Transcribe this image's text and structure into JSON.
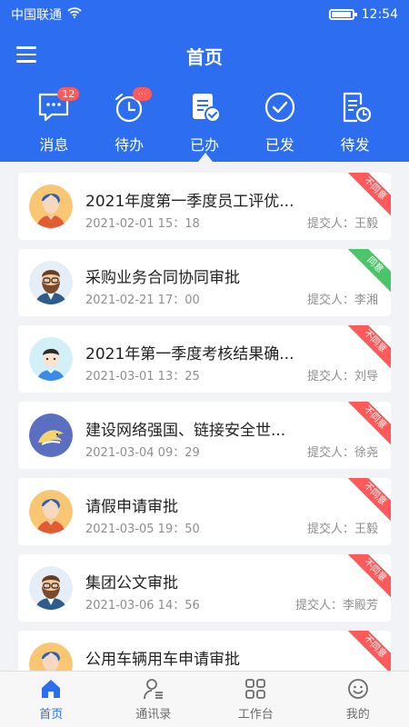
{
  "status": {
    "carrier": "中国联通",
    "time": "12:54",
    "battery_level": 0.95
  },
  "header": {
    "title": "首页"
  },
  "tabs": [
    {
      "label": "消息",
      "icon": "message-icon",
      "badge": "12"
    },
    {
      "label": "待办",
      "icon": "alarm-clock-icon",
      "badge": "···"
    },
    {
      "label": "已办",
      "icon": "document-check-icon",
      "active": true
    },
    {
      "label": "已发",
      "icon": "check-circle-icon"
    },
    {
      "label": "待发",
      "icon": "document-clock-icon"
    }
  ],
  "items": [
    {
      "title": "2021年度第一季度员工评优...",
      "date": "2021-02-01   15：18",
      "submitter": "提交人：王毅",
      "status": "不同意",
      "status_color": "#ff5a5a",
      "avatar": "avatar-woman-orange"
    },
    {
      "title": "采购业务合同协同审批",
      "date": "2021-02-21   17：00",
      "submitter": "提交人：李湘",
      "status": "同意",
      "status_color": "#4cc46a",
      "avatar": "avatar-man-beard"
    },
    {
      "title": "2021年第一季度考核结果确...",
      "date": "2021-03-01   13：25",
      "submitter": "提交人：刘导",
      "status": "不同意",
      "status_color": "#ff5a5a",
      "avatar": "avatar-boy-blue"
    },
    {
      "title": "建设网络强国、链接安全世...",
      "date": "2021-03-04   09：29",
      "submitter": "提交人：徐尧",
      "status": "不同意",
      "status_color": "#ff5a5a",
      "avatar": "avatar-dolphin-logo"
    },
    {
      "title": "请假申请审批",
      "date": "2021-03-05   19：50",
      "submitter": "提交人：王毅",
      "status": "不同意",
      "status_color": "#ff5a5a",
      "avatar": "avatar-woman-orange"
    },
    {
      "title": "集团公文审批",
      "date": "2021-03-06   14：56",
      "submitter": "提交人：李殿芳",
      "status": "不同意",
      "status_color": "#ff5a5a",
      "avatar": "avatar-man-beard"
    },
    {
      "title": "公用车辆用车申请审批",
      "date": "",
      "submitter": "",
      "status": "不同意",
      "status_color": "#ff5a5a",
      "avatar": "avatar-woman-orange"
    }
  ],
  "bottom_nav": [
    {
      "label": "首页",
      "icon": "home-icon",
      "active": true
    },
    {
      "label": "通讯录",
      "icon": "contacts-icon"
    },
    {
      "label": "工作台",
      "icon": "grid-icon"
    },
    {
      "label": "我的",
      "icon": "smile-icon"
    }
  ],
  "colors": {
    "primary": "#2d6ef0",
    "reject": "#ff5a5a",
    "approve": "#4cc46a"
  }
}
